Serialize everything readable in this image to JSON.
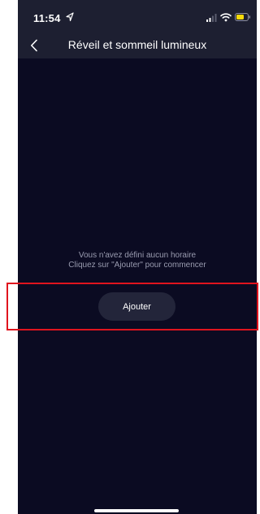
{
  "status_bar": {
    "time": "11:54",
    "icons": [
      "location-arrow-icon",
      "cellular-signal-icon",
      "wifi-icon",
      "battery-icon"
    ]
  },
  "nav": {
    "back_icon": "chevron-left-icon",
    "title": "Réveil et sommeil lumineux"
  },
  "empty_state": {
    "line1": "Vous n'avez défini aucun horaire",
    "line2": "Cliquez sur \"Ajouter\" pour commencer"
  },
  "add_button": {
    "label": "Ajouter"
  },
  "colors": {
    "background": "#0b0b22",
    "header": "#1d1f31",
    "button": "#23253a",
    "battery": "#f5d90a",
    "highlight": "#e0141e"
  }
}
